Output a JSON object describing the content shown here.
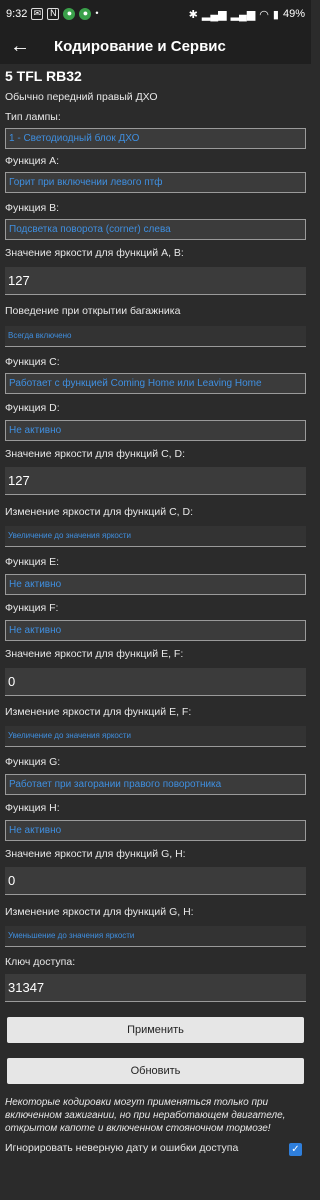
{
  "statusbar": {
    "time": "9:32",
    "battery": "49%"
  },
  "header": {
    "title": "Кодирование и Сервис"
  },
  "model": "5 TFL RB32",
  "description": "Обычно передний правый ДХО",
  "fields": {
    "lamp_type_label": "Тип лампы:",
    "lamp_type_value": "1 - Светодиодный блок ДХО",
    "func_a_label": "Функция A:",
    "func_a_value": "Горит при включении левого птф",
    "func_b_label": "Функция B:",
    "func_b_value": "Подсветка поворота (corner) слева",
    "brightness_ab_label": "Значение яркости для функций A, B:",
    "brightness_ab_value": "127",
    "trunk_label": "Поведение при открытии багажника",
    "trunk_value": "Всегда включено",
    "func_c_label": "Функция C:",
    "func_c_value": "Работает с функцией Coming Home или Leaving Home",
    "func_d_label": "Функция D:",
    "func_d_value": "Не активно",
    "brightness_cd_label": "Значение яркости для функций C, D:",
    "brightness_cd_value": "127",
    "change_cd_label": "Изменение яркости для функций C, D:",
    "change_cd_value": "Увеличение до значения яркости",
    "func_e_label": "Функция E:",
    "func_e_value": "Не активно",
    "func_f_label": "Функция F:",
    "func_f_value": "Не активно",
    "brightness_ef_label": "Значение яркости для функций E, F:",
    "brightness_ef_value": "0",
    "change_ef_label": "Изменение яркости для функций E, F:",
    "change_ef_value": "Увеличение до значения яркости",
    "func_g_label": "Функция G:",
    "func_g_value": "Работает при загорании правого поворотника",
    "func_h_label": "Функция H:",
    "func_h_value": "Не активно",
    "brightness_gh_label": "Значение яркости для функций G, H:",
    "brightness_gh_value": "0",
    "change_gh_label": "Изменение яркости для функций G, H:",
    "change_gh_value": "Уменьшение до значения яркости",
    "access_key_label": "Ключ доступа:",
    "access_key_value": "31347"
  },
  "buttons": {
    "apply": "Применить",
    "refresh": "Обновить"
  },
  "note": "Некоторые кодировки могут применяться только при включенном зажигании, но при неработающем двигателе, открытом капоте и включенном стояночном тормозе!",
  "ignore_label": "Игнорировать неверную дату и ошибки доступа",
  "ignore_checked": true
}
